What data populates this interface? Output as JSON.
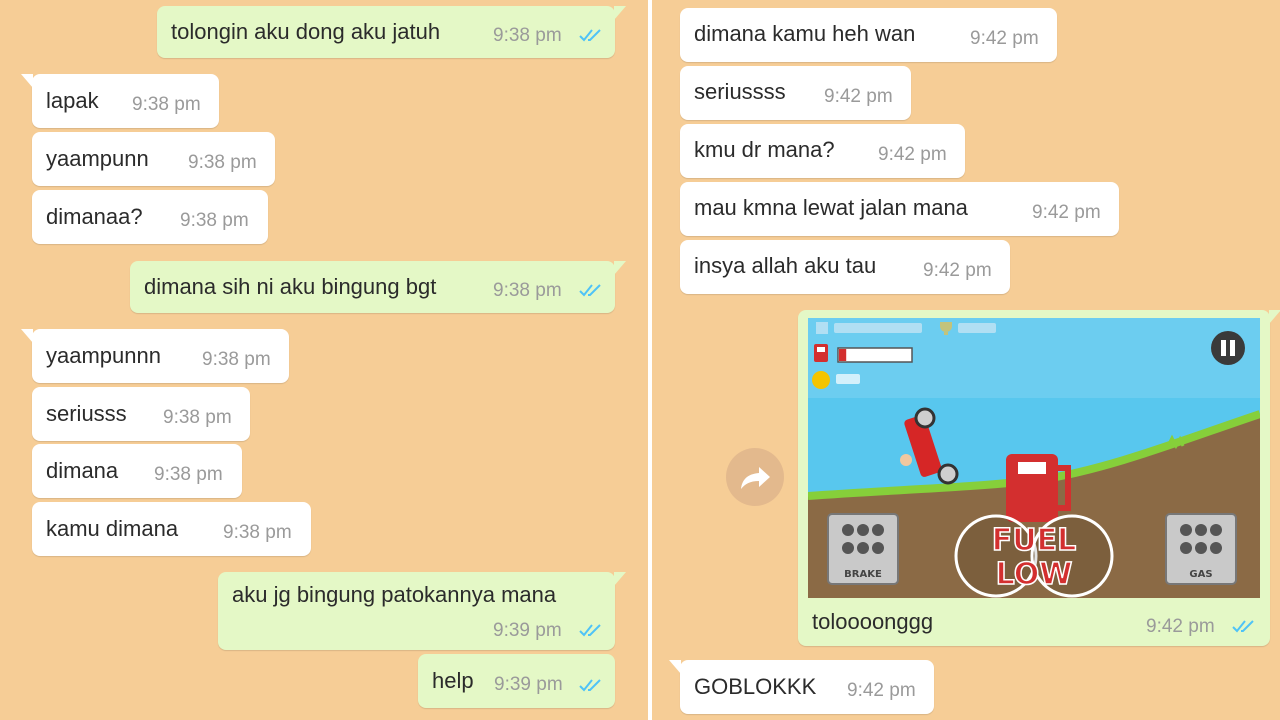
{
  "left": {
    "messages": [
      {
        "text": "tolongin aku dong aku jatuh",
        "time": "9:38 pm",
        "dir": "out"
      },
      {
        "text": "lapak",
        "time": "9:38 pm",
        "dir": "in"
      },
      {
        "text": "yaampunn",
        "time": "9:38 pm",
        "dir": "in"
      },
      {
        "text": "dimanaa?",
        "time": "9:38 pm",
        "dir": "in"
      },
      {
        "text": "dimana sih ni aku bingung bgt",
        "time": "9:38 pm",
        "dir": "out"
      },
      {
        "text": "yaampunnn",
        "time": "9:38 pm",
        "dir": "in"
      },
      {
        "text": "seriusss",
        "time": "9:38 pm",
        "dir": "in"
      },
      {
        "text": "dimana",
        "time": "9:38 pm",
        "dir": "in"
      },
      {
        "text": "kamu dimana",
        "time": "9:38 pm",
        "dir": "in"
      },
      {
        "text": "aku jg bingung patokannya mana",
        "time": "9:39 pm",
        "dir": "out"
      },
      {
        "text": "help",
        "time": "9:39 pm",
        "dir": "out"
      }
    ]
  },
  "right": {
    "messages": [
      {
        "text": "dimana kamu heh wan",
        "time": "9:42 pm",
        "dir": "in"
      },
      {
        "text": "seriussss",
        "time": "9:42 pm",
        "dir": "in"
      },
      {
        "text": "kmu dr mana?",
        "time": "9:42 pm",
        "dir": "in"
      },
      {
        "text": "mau kmna lewat jalan mana",
        "time": "9:42 pm",
        "dir": "in"
      },
      {
        "text": "insya allah aku tau",
        "time": "9:42 pm",
        "dir": "in"
      },
      {
        "text": "GOBLOKKK",
        "time": "9:42 pm",
        "dir": "in"
      }
    ],
    "image_message": {
      "caption": "toloooonggg",
      "time": "9:42 pm",
      "dir": "out",
      "game_screenshot": {
        "fuel_warning_line1": "FUEL",
        "fuel_warning_line2": "LOW",
        "brake_label": "BRAKE",
        "gas_label": "GAS",
        "fuel_level": 0.1
      }
    }
  },
  "colors": {
    "chat_background": "#f6cd96",
    "incoming_bubble": "#ffffff",
    "outgoing_bubble": "#e4f8c6",
    "read_ticks": "#4fc3f7",
    "timestamp": "#9a9a9a"
  },
  "icons": [
    "double-check-icon",
    "forward-icon",
    "pause-icon",
    "fuel-pump-icon",
    "coin-icon",
    "trophy-icon"
  ]
}
